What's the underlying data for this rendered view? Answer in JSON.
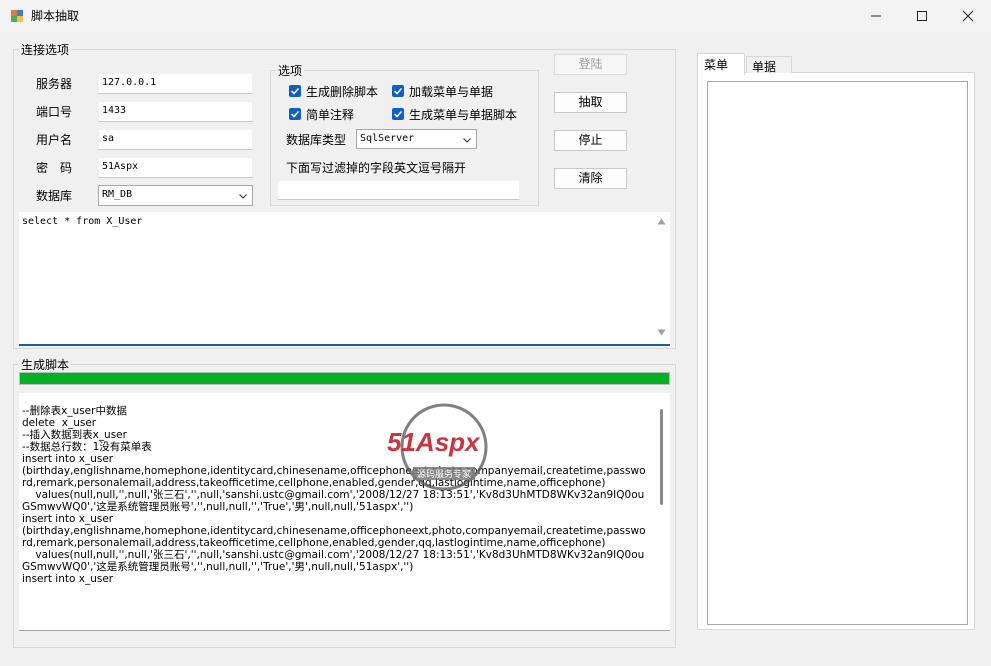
{
  "window": {
    "title": "脚本抽取"
  },
  "connection": {
    "group_label": "连接选项",
    "server_label": "服务器",
    "server_value": "127.0.0.1",
    "port_label": "端口号",
    "port_value": "1433",
    "user_label": "用户名",
    "user_value": "sa",
    "password_label": "密　码",
    "password_value": "51Aspx",
    "database_label": "数据库",
    "database_value": "RM_DB"
  },
  "options": {
    "group_label": "选项",
    "gen_delete_script": "生成删除脚本",
    "load_menu_docs": "加载菜单与单据",
    "simple_comment": "简单注释",
    "gen_menu_docs_script": "生成菜单与单据脚本",
    "db_type_label": "数据库类型",
    "db_type_value": "SqlServer",
    "filter_label": "下面写过滤掉的字段英文逗号隔开",
    "filter_value": ""
  },
  "buttons": {
    "login": "登陆",
    "extract": "抽取",
    "stop": "停止",
    "clear": "清除"
  },
  "query": {
    "text": "select * from X_User"
  },
  "output": {
    "group_label": "生成脚本",
    "progress": 1.0,
    "script": "--删除表x_user中数据\ndelete  x_user\n--插入数据到表x_user\n--数据总行数：1没有菜单表\ninsert into x_user\n(birthday,englishname,homephone,identitycard,chinesename,officephoneext,photo,companyemail,createtime,password,remark,personalemail,address,takeofficetime,cellphone,enabled,gender,qq,lastlogintime,name,officephone)\n    values(null,null,'',null,'张三石','',null,'sanshi.ustc@gmail.com','2008/12/27 18:13:51','Kv8d3UhMTD8WKv32an9IQ0ouGSmwvWQ0','这是系统管理员账号','',null,null,'','True','男',null,null,'51aspx','')\ninsert into x_user\n(birthday,englishname,homephone,identitycard,chinesename,officephoneext,photo,companyemail,createtime,password,remark,personalemail,address,takeofficetime,cellphone,enabled,gender,qq,lastlogintime,name,officephone)\n    values(null,null,'',null,'张三石','',null,'sanshi.ustc@gmail.com','2008/12/27 18:13:51','Kv8d3UhMTD8WKv32an9IQ0ouGSmwvWQ0','这是系统管理员账号','',null,null,'','True','男',null,null,'51aspx','')\ninsert into x_user"
  },
  "watermark": {
    "brand": "51Aspx",
    "tagline": "源码服务专家"
  },
  "tabs": {
    "menu": "菜单",
    "docs": "单据"
  },
  "colors": {
    "progress": "#06b025",
    "checkbox": "#0f5fc4",
    "input_border": "#1a5fa8"
  },
  "icons": {
    "app": "app-icon",
    "minimize": "minimize-icon",
    "maximize": "maximize-icon",
    "close": "close-icon"
  }
}
